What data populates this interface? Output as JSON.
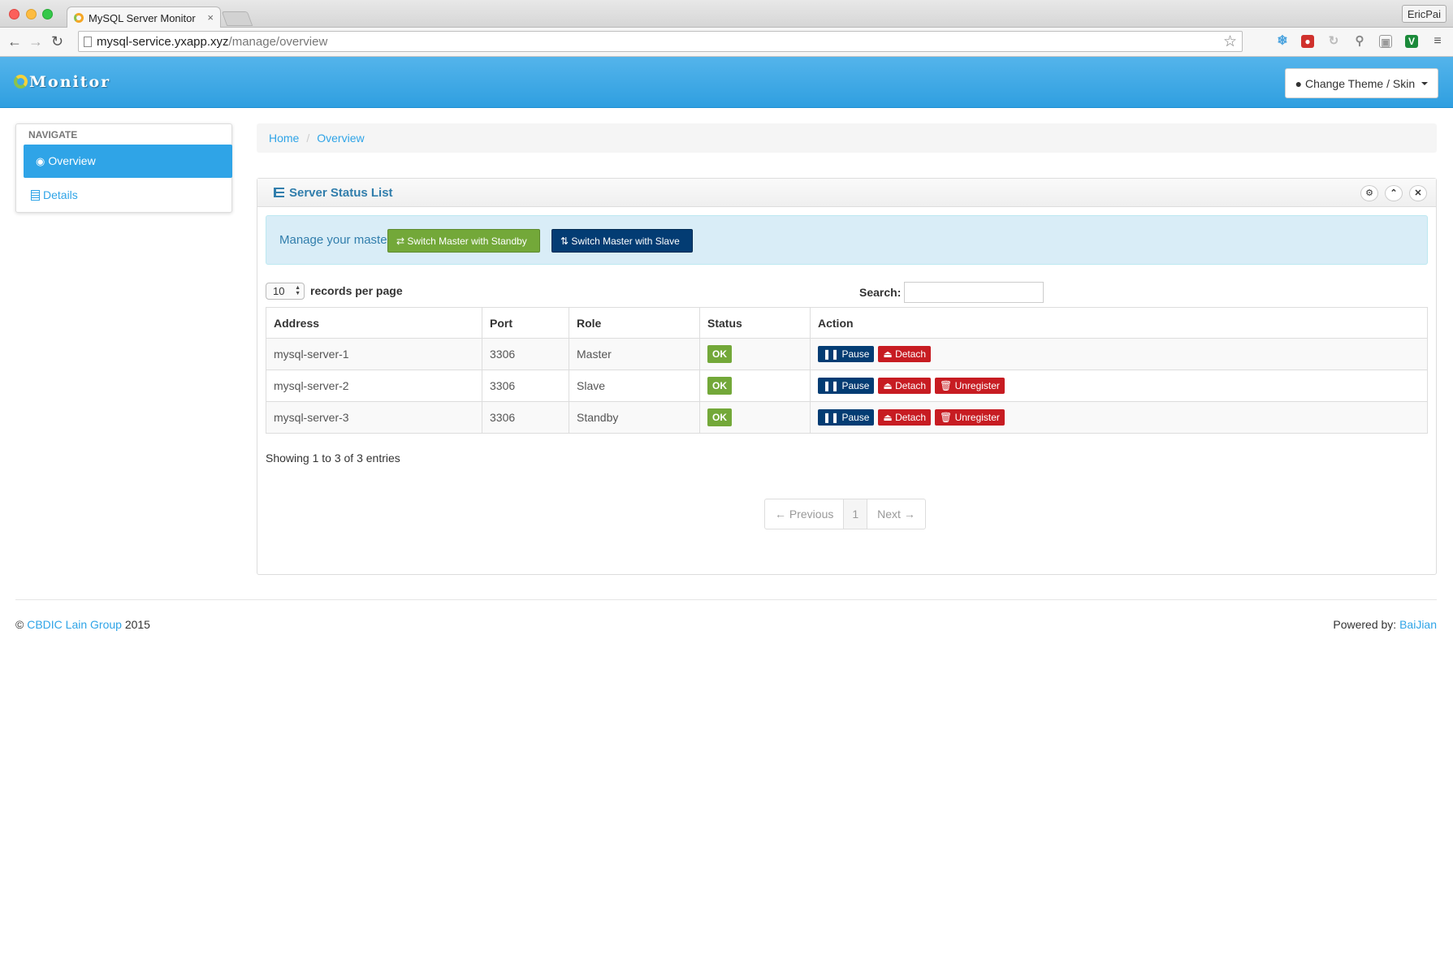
{
  "browser": {
    "tab_title": "MySQL Server Monitor",
    "tab_close": "×",
    "url_host": "mysql-service.yxapp.xyz",
    "url_path": "/manage/overview",
    "profile_name": "EricPai"
  },
  "navbar": {
    "brand": "Monitor",
    "theme_button": "Change Theme / Skin"
  },
  "sidebar": {
    "header": "NAVIGATE",
    "items": [
      {
        "label": "Overview",
        "icon": "eye-icon",
        "active": true
      },
      {
        "label": "Details",
        "icon": "document-icon",
        "active": false
      }
    ]
  },
  "breadcrumb": {
    "home": "Home",
    "separator": "/",
    "current": "Overview"
  },
  "panel": {
    "title": "Server Status List",
    "controls": [
      "gear-icon",
      "chevron-up-icon",
      "close-icon"
    ]
  },
  "alert": {
    "text": "Manage your master",
    "switch_standby": "Switch Master with Standby",
    "switch_slave": "Switch Master with Slave"
  },
  "table_controls": {
    "page_length": "10",
    "page_length_label": "records per page",
    "search_label": "Search:",
    "search_value": ""
  },
  "table": {
    "columns": [
      "Address",
      "Port",
      "Role",
      "Status",
      "Action"
    ],
    "rows": [
      {
        "address": "mysql-server-1",
        "port": "3306",
        "role": "Master",
        "status": "OK",
        "actions": [
          "Pause",
          "Detach"
        ]
      },
      {
        "address": "mysql-server-2",
        "port": "3306",
        "role": "Slave",
        "status": "OK",
        "actions": [
          "Pause",
          "Detach",
          "Unregister"
        ]
      },
      {
        "address": "mysql-server-3",
        "port": "3306",
        "role": "Standby",
        "status": "OK",
        "actions": [
          "Pause",
          "Detach",
          "Unregister"
        ]
      }
    ]
  },
  "table_info": "Showing 1 to 3 of 3 entries",
  "pagination": {
    "previous": "← Previous",
    "page": "1",
    "next": "Next →"
  },
  "footer": {
    "copyright_symbol": "©",
    "org_link": "CBDIC Lain Group",
    "year": "2015",
    "powered_label": "Powered by:",
    "powered_link": "BaiJian"
  },
  "colors": {
    "navbar": "#2fa4e7",
    "link": "#2fa4e7",
    "success": "#73a839",
    "navy": "#033c73",
    "danger": "#c71c22",
    "alert_bg": "#d9edf7"
  }
}
